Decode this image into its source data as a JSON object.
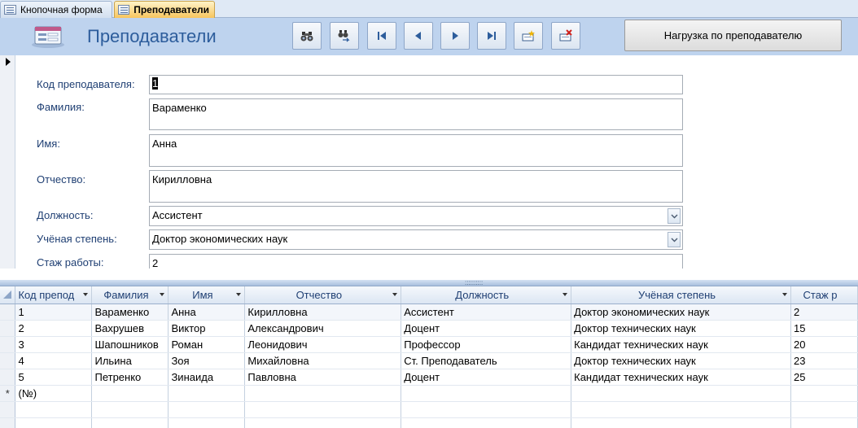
{
  "tabs": [
    {
      "label": "Кнопочная форма",
      "active": false
    },
    {
      "label": "Преподаватели",
      "active": true
    }
  ],
  "header": {
    "title": "Преподаватели",
    "nav_buttons": [
      {
        "icon": "binoculars-find-icon",
        "title": "Найти"
      },
      {
        "icon": "binoculars-replace-icon",
        "title": "Заменить"
      },
      {
        "icon": "first-record-icon",
        "title": "Первая запись"
      },
      {
        "icon": "previous-record-icon",
        "title": "Предыдущая запись"
      },
      {
        "icon": "next-record-icon",
        "title": "Следующая запись"
      },
      {
        "icon": "last-record-icon",
        "title": "Последняя запись"
      },
      {
        "icon": "new-record-icon",
        "title": "Новая запись"
      },
      {
        "icon": "delete-record-icon",
        "title": "Удалить запись"
      }
    ],
    "report_button": "Нагрузка по преподавателю"
  },
  "form": {
    "id_label": "Код преподавателя:",
    "id_value": "1",
    "lastname_label": "Фамилия:",
    "lastname_value": "Вараменко",
    "firstname_label": "Имя:",
    "firstname_value": "Анна",
    "patronymic_label": "Отчество:",
    "patronymic_value": "Кирилловна",
    "position_label": "Должность:",
    "position_value": "Ассистент",
    "degree_label": "Учёная степень:",
    "degree_value": "Доктор экономических наук",
    "experience_label": "Стаж работы:",
    "experience_value": "2"
  },
  "grid": {
    "columns": [
      "Код препод",
      "Фамилия",
      "Имя",
      "Отчество",
      "Должность",
      "Учёная степень",
      "Стаж р"
    ],
    "rows": [
      {
        "id": "1",
        "lastname": "Вараменко",
        "firstname": "Анна",
        "patronymic": "Кирилловна",
        "position": "Ассистент",
        "degree": "Доктор экономических наук",
        "experience": "2"
      },
      {
        "id": "2",
        "lastname": "Вахрушев",
        "firstname": "Виктор",
        "patronymic": "Александрович",
        "position": "Доцент",
        "degree": "Доктор технических наук",
        "experience": "15"
      },
      {
        "id": "3",
        "lastname": "Шапошников",
        "firstname": "Роман",
        "patronymic": "Леонидович",
        "position": "Профессор",
        "degree": "Кандидат технических наук",
        "experience": "20"
      },
      {
        "id": "4",
        "lastname": "Ильина",
        "firstname": "Зоя",
        "patronymic": "Михайловна",
        "position": "Ст. Преподаватель",
        "degree": "Доктор технических наук",
        "experience": "23"
      },
      {
        "id": "5",
        "lastname": "Петренко",
        "firstname": "Зинаида",
        "patronymic": "Павловна",
        "position": "Доцент",
        "degree": "Кандидат технических наук",
        "experience": "25"
      }
    ],
    "new_row_marker": "*",
    "new_row_placeholder": "(№)"
  },
  "colors": {
    "header_bg": "#bed3ee",
    "title_color": "#2d5d9c",
    "active_tab": "#f7c55e"
  }
}
